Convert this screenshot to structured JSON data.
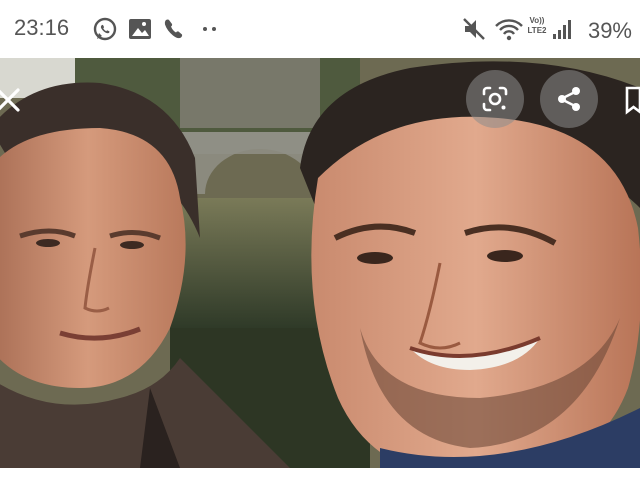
{
  "status_bar": {
    "time": "23:16",
    "left_icons": [
      "whatsapp-icon",
      "image-icon",
      "phone-icon",
      "more-dots-icon"
    ],
    "right_icons": [
      "mute-icon",
      "wifi-icon",
      "volte-icon",
      "signal-icon"
    ],
    "volte_label_top": "Vo))",
    "volte_label_bottom": "LTE2",
    "battery": "39%"
  },
  "viewer": {
    "controls": [
      "close-icon",
      "lens-search-icon",
      "share-icon",
      "bookmark-icon"
    ]
  },
  "colors": {
    "status_text": "#555555",
    "button_bg": "rgba(140,140,140,0.55)",
    "icon": "#ffffff"
  }
}
